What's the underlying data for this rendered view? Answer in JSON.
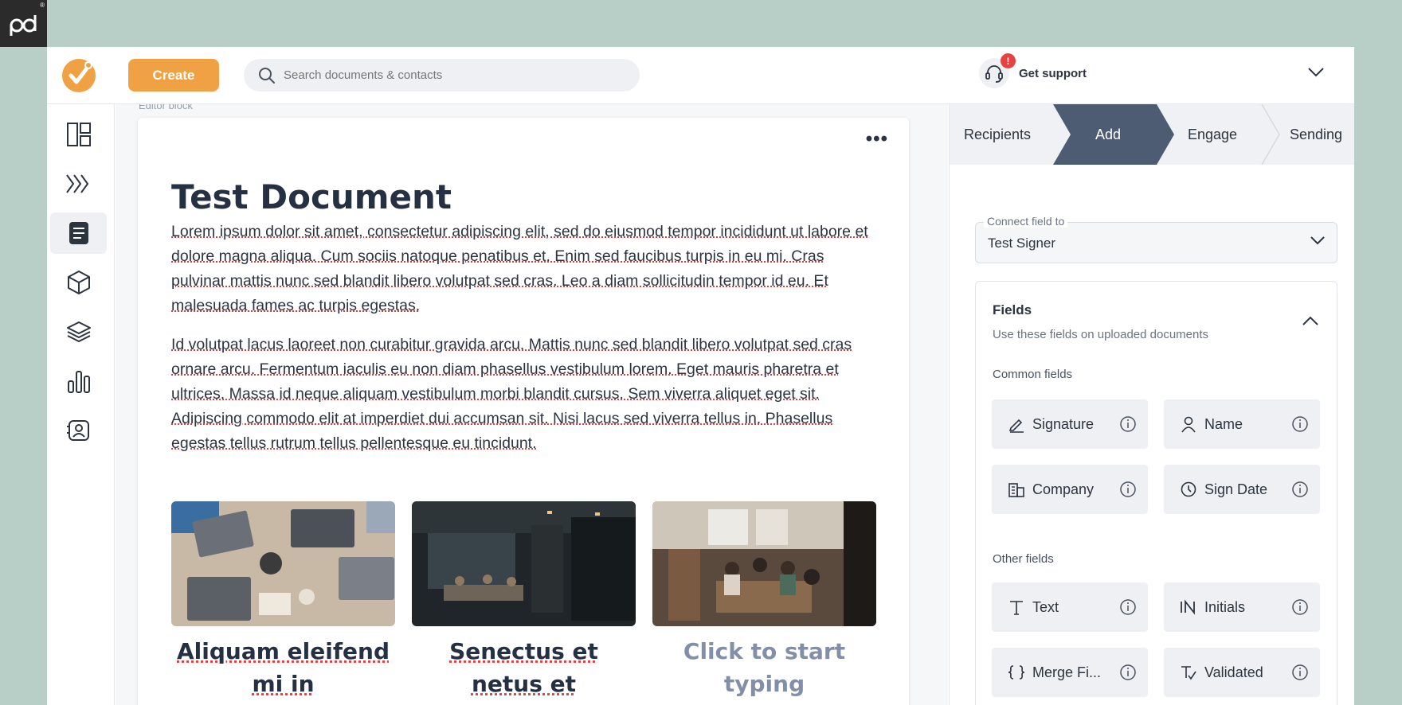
{
  "header": {
    "create_label": "Create",
    "search_placeholder": "Search documents & contacts",
    "support_label": "Get support",
    "support_badge": "!"
  },
  "editor": {
    "caption": "Editor block",
    "title": "Test Document",
    "paragraph1": "Lorem ipsum dolor sit amet, consectetur adipiscing elit, sed do eiusmod tempor incididunt ut labore et dolore magna aliqua. Cum sociis natoque penatibus et. Enim sed faucibus turpis in eu mi. Cras pulvinar mattis nunc sed blandit libero volutpat sed cras. Leo a diam sollicitudin tempor id eu. Et malesuada fames ac turpis egestas.",
    "paragraph2": "Id volutpat lacus laoreet non curabitur gravida arcu. Mattis nunc sed blandit libero volutpat sed cras ornare arcu. Fermentum iaculis eu non diam phasellus vestibulum lorem. Eget mauris pharetra et ultrices. Massa id neque aliquam vestibulum morbi blandit cursus. Sem viverra aliquet eget sit. Adipiscing commodo elit at imperdiet dui accumsan sit. Nisi lacus sed viverra tellus in. Phasellus egestas tellus rutrum tellus pellentesque eu tincidunt.",
    "captions": [
      "Aliquam eleifend mi in",
      "Senectus et netus et",
      "Click to start typing"
    ]
  },
  "workflow": {
    "steps": [
      "Recipients",
      "Add",
      "Engage",
      "Sending"
    ],
    "active": "Add"
  },
  "panel": {
    "connect_label": "Connect field to",
    "connect_value": "Test Signer",
    "fields_title": "Fields",
    "fields_subtitle": "Use these fields on uploaded documents",
    "common_label": "Common fields",
    "other_label": "Other fields",
    "common_fields": [
      "Signature",
      "Name",
      "Company",
      "Sign Date"
    ],
    "other_fields": [
      "Text",
      "Initials",
      "Merge Fi...",
      "Validated"
    ]
  },
  "colors": {
    "accent": "#f0a143",
    "active_step": "#4d5b73",
    "background": "#b7cfc6"
  }
}
